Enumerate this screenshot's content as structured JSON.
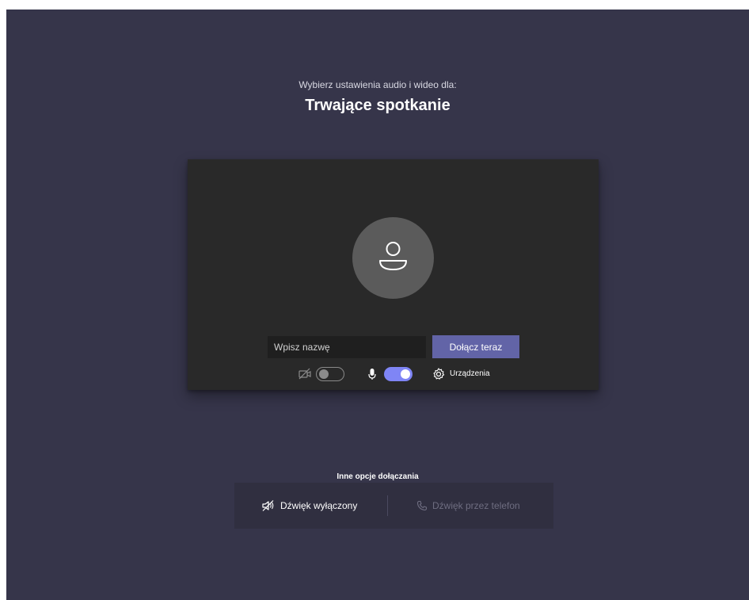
{
  "header": {
    "subtitle": "Wybierz ustawienia audio i wideo dla:",
    "meeting_title": "Trwające spotkanie"
  },
  "preview": {
    "avatar_icon": "person-icon",
    "name_placeholder": "Wpisz nazwę",
    "name_value": "",
    "join_label": "Dołącz teraz"
  },
  "controls": {
    "camera": {
      "icon": "camera-off-icon",
      "enabled": false
    },
    "microphone": {
      "icon": "microphone-icon",
      "enabled": true
    },
    "devices_label": "Urządzenia",
    "devices_icon": "gear-icon"
  },
  "other_options": {
    "label": "Inne opcje dołączania",
    "audio_off_label": "Dźwięk wyłączony",
    "audio_off_icon": "speaker-off-icon",
    "phone_label": "Dźwięk przez telefon",
    "phone_icon": "phone-icon"
  },
  "colors": {
    "background": "#36354a",
    "card": "#292929",
    "accent": "#6264a7",
    "toggle_on": "#7f85f5"
  }
}
